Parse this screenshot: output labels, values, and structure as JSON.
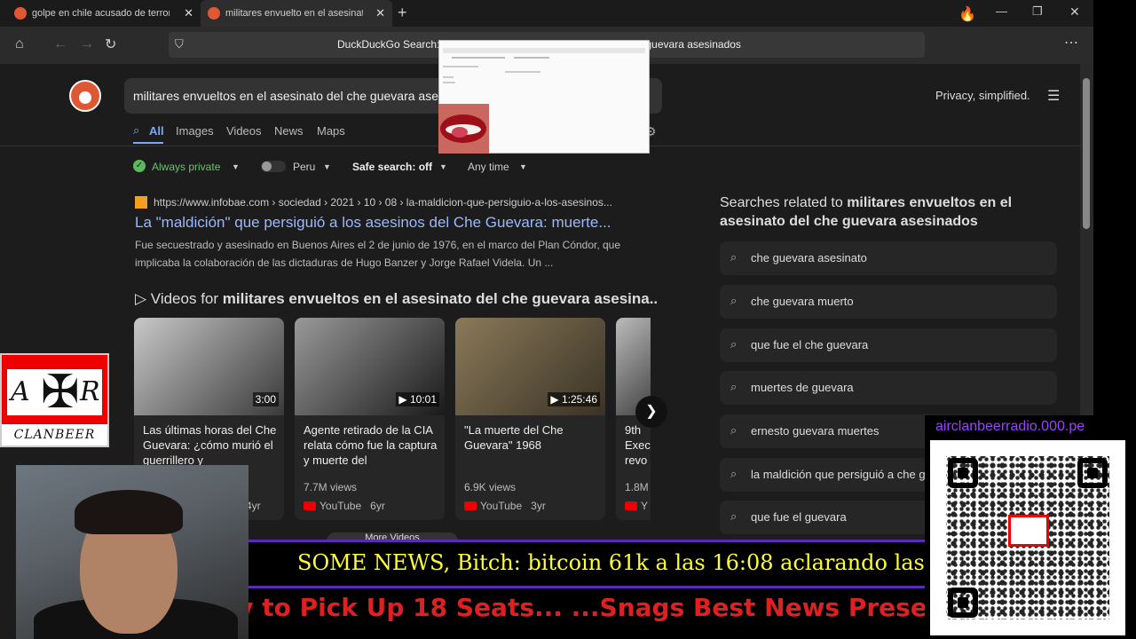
{
  "browser": {
    "tabs": [
      {
        "label": "golpe en chile acusado de terror"
      },
      {
        "label": "militares envuelto en el asesinat"
      }
    ],
    "new_tab": "+",
    "window_controls": [
      "—",
      "❐",
      "✕"
    ],
    "url_text": "DuckDuckGo Search: militares envueltos en el asesinato del che guevara asesinados",
    "menu": "⋯"
  },
  "search": {
    "query": "militares envueltos en el asesinato del che guevara asesinados",
    "privacy": "Privacy, simplified.",
    "tabs": [
      "All",
      "Images",
      "Videos",
      "News",
      "Maps"
    ],
    "filters": {
      "always_private": "Always private",
      "region": "Peru",
      "safe_search": "Safe search: off",
      "time": "Any time"
    }
  },
  "result": {
    "url": "https://www.infobae.com › sociedad › 2021 › 10 › 08 › la-maldicion-que-persiguio-a-los-asesinos...",
    "title": "La \"maldición\" que persiguió a los asesinos del Che Guevara: muerte...",
    "snippet": "Fue secuestrado y asesinado en Buenos Aires el 2 de junio de 1976, en el marco del Plan Cóndor, que implicaba la colaboración de las dictaduras de Hugo Banzer y Jorge Rafael Videla. Un ..."
  },
  "videos": {
    "header_prefix": "Videos for ",
    "header_query": "militares envueltos en el asesinato del che guevara asesina...",
    "items": [
      {
        "duration": "3:00",
        "title": "Las últimas horas del Che Guevara: ¿cómo murió el guerrillero y",
        "views": "",
        "source": "",
        "age": "4yr"
      },
      {
        "duration": "10:01",
        "title": "Agente retirado de la CIA relata cómo fue la captura y muerte del",
        "views": "7.7M views",
        "source": "YouTube",
        "age": "6yr"
      },
      {
        "duration": "1:25:46",
        "title": "\"La muerte del Che Guevara\" 1968",
        "views": "6.9K views",
        "source": "YouTube",
        "age": "3yr"
      },
      {
        "duration": "",
        "title": "9th Exec revo",
        "views": "1.8M",
        "source": "Y",
        "age": ""
      }
    ],
    "more": "More Videos"
  },
  "related": {
    "heading_prefix": "Searches related to ",
    "heading_query": "militares envueltos en el asesinato del che guevara asesinados",
    "items": [
      "che guevara asesinato",
      "che guevara muerto",
      "que fue el che guevara",
      "muertes de guevara",
      "ernesto guevara muertes",
      "la maldición que persiguió a che g",
      "que fue el guevara"
    ]
  },
  "overlay": {
    "logo_a": "A",
    "logo_r": "R",
    "logo_text": "CLANBEER",
    "ticker_top": "SOME NEWS, Bitch: bitcoin 61k a las 16:08 aclarando las co",
    "ticker_bottom": "rty to Pick Up 18 Seats... ...Snags Best News Presen",
    "qr_url": "airclanbeerradio.000.pe"
  },
  "colors": {
    "accent": "#7aa7ff",
    "ddg": "#de5833",
    "ticker_yellow": "#ffff33",
    "ticker_red": "#e02020",
    "purple": "#5b2ab8"
  }
}
